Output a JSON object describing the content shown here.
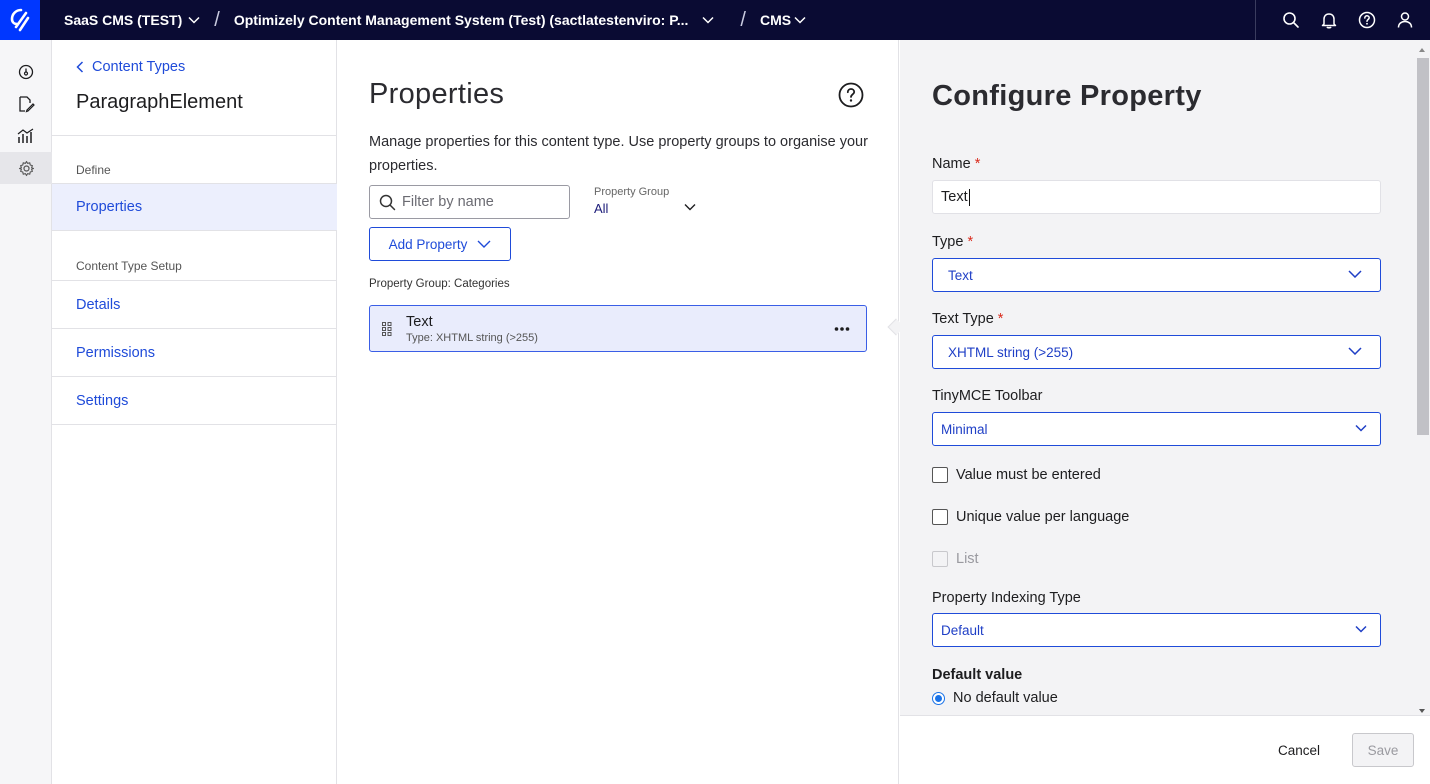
{
  "topbar": {
    "breadcrumbs": [
      {
        "label": "SaaS CMS (TEST)"
      },
      {
        "label": "Optimizely Content Management System (Test) (sactlatestenviro: P..."
      },
      {
        "label": "CMS"
      }
    ],
    "icons": [
      "search-icon",
      "bell-icon",
      "help-icon",
      "user-icon"
    ]
  },
  "rail": {
    "icons": [
      "dashboard-icon",
      "edit-icon",
      "analytics-icon",
      "settings-icon"
    ]
  },
  "subnav": {
    "back_label": "Content Types",
    "content_type_name": "ParagraphElement",
    "define_label": "Define",
    "properties_label": "Properties",
    "setup_label": "Content Type Setup",
    "details_label": "Details",
    "permissions_label": "Permissions",
    "settings_label": "Settings"
  },
  "properties_panel": {
    "title": "Properties",
    "description": "Manage properties for this content type. Use property groups to organise your properties.",
    "filter_placeholder": "Filter by name",
    "property_group_label": "Property Group",
    "property_group_value": "All",
    "add_property_label": "Add Property",
    "group_heading": "Property Group: Categories",
    "items": [
      {
        "name": "Text",
        "type": "Type: XHTML string (>255)"
      }
    ]
  },
  "configure": {
    "title": "Configure Property",
    "name_label": "Name",
    "name_value": "Text",
    "type_label": "Type",
    "type_value": "Text",
    "text_type_label": "Text Type",
    "text_type_value": "XHTML string (>255)",
    "toolbar_label": "TinyMCE Toolbar",
    "toolbar_value": "Minimal",
    "required_marker": "*",
    "checkboxes": [
      {
        "label": "Value must be entered",
        "checked": false,
        "disabled": false
      },
      {
        "label": "Unique value per language",
        "checked": false,
        "disabled": false
      },
      {
        "label": "List",
        "checked": false,
        "disabled": true
      }
    ],
    "indexing_label": "Property Indexing Type",
    "indexing_value": "Default",
    "default_value_label": "Default value",
    "default_option": "No default value",
    "cancel_label": "Cancel",
    "save_label": "Save"
  },
  "colors": {
    "topbar_bg": "#0a0b33",
    "logo_bg": "#0037ff",
    "accent": "#1f4bd9",
    "required": "#d92a1c"
  }
}
